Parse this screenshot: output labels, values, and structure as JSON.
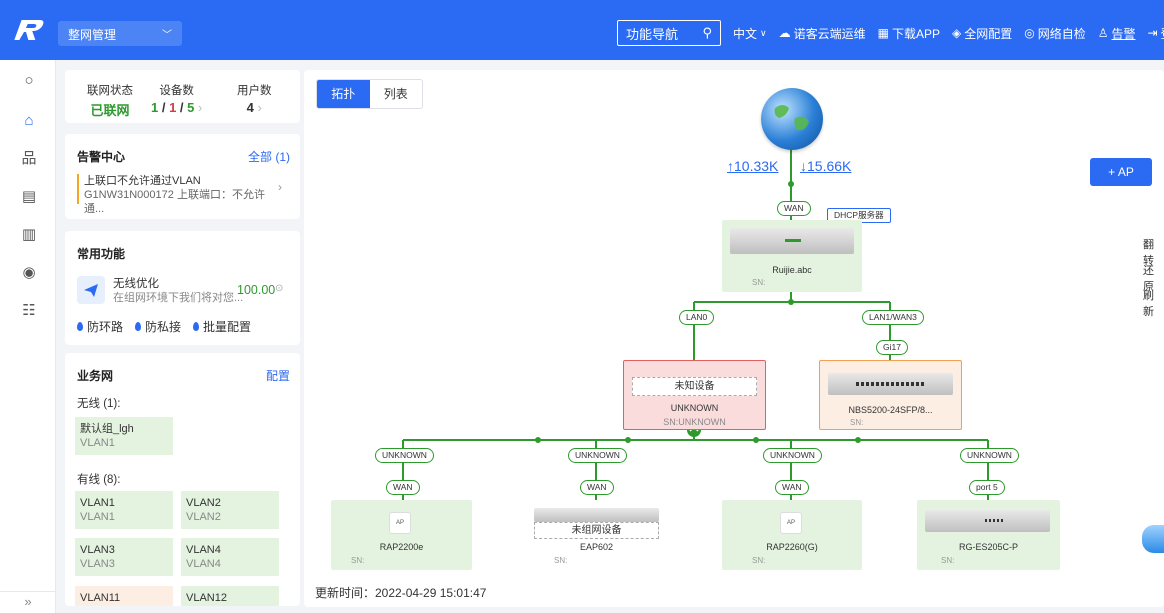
{
  "header": {
    "network_select": "整网管理",
    "nav_search": "功能导航",
    "language": "中文",
    "items": [
      "诺客云端运维",
      "下载APP",
      "全网配置",
      "网络自检",
      "告警",
      "登出"
    ]
  },
  "stats": {
    "network_status_label": "联网状态",
    "network_status_value": "已联网",
    "device_count_label": "设备数",
    "device_count_a": "1",
    "device_count_b": "1",
    "device_count_c": "5",
    "user_count_label": "用户数",
    "user_count_value": "4"
  },
  "alarm": {
    "title": "告警中心",
    "link": "全部 (1)",
    "item_title": "上联口不允许通过VLAN",
    "item_sub": "G1NW31N000172 上联端口：不允许通..."
  },
  "common": {
    "title": "常用功能",
    "opt_title": "无线优化",
    "opt_sub": "在组网环境下我们将对您...",
    "opt_value": "100.00",
    "features": [
      "防环路",
      "防私接",
      "批量配置"
    ]
  },
  "business": {
    "title": "业务网",
    "link": "配置",
    "wireless_label": "无线 (1):",
    "wireless": [
      {
        "name": "默认组_lgh",
        "vlan": "VLAN1"
      }
    ],
    "wired_label": "有线 (8):",
    "wired": [
      {
        "name": "VLAN1",
        "vlan": "VLAN1"
      },
      {
        "name": "VLAN2",
        "vlan": "VLAN2"
      },
      {
        "name": "VLAN3",
        "vlan": "VLAN3"
      },
      {
        "name": "VLAN4",
        "vlan": "VLAN4"
      },
      {
        "name": "VLAN11",
        "vlan": ""
      },
      {
        "name": "VLAN12",
        "vlan": ""
      }
    ]
  },
  "main": {
    "tabs": [
      "拓扑",
      "列表"
    ],
    "add_ap": "+ AP",
    "side_actions": [
      "翻转",
      "还原",
      "刷新"
    ],
    "update_time": "更新时间：2022-04-29 15:01:47"
  },
  "topology": {
    "upload": "↑10.33K",
    "download": "↓15.66K",
    "wan_tag": "WAN",
    "dhcp_tag": "DHCP服务器",
    "gateway": {
      "name": "Ruijie.abc",
      "sn": "SN:"
    },
    "lan0_tag": "LAN0",
    "lan1_tag": "LAN1/WAN3",
    "gi_tag": "Gi17",
    "unknown": {
      "label": "未知设备",
      "name": "UNKNOWN",
      "sn": "SN:UNKNOWN"
    },
    "switch": {
      "name": "NBS5200-24SFP/8...",
      "sn": "SN:"
    },
    "children": [
      {
        "up": "UNKNOWN",
        "down": "WAN",
        "name": "RAP2200e",
        "sn": "SN:",
        "box_label": "AP"
      },
      {
        "up": "UNKNOWN",
        "down": "WAN",
        "name": "EAP602",
        "sn": "SN:",
        "box_label": "未组网设备"
      },
      {
        "up": "UNKNOWN",
        "down": "WAN",
        "name": "RAP2260(G)",
        "sn": "SN:",
        "box_label": "AP"
      },
      {
        "up": "UNKNOWN",
        "down": "port 5",
        "name": "RG-ES205C-P",
        "sn": "SN:",
        "box_label": ""
      }
    ]
  }
}
